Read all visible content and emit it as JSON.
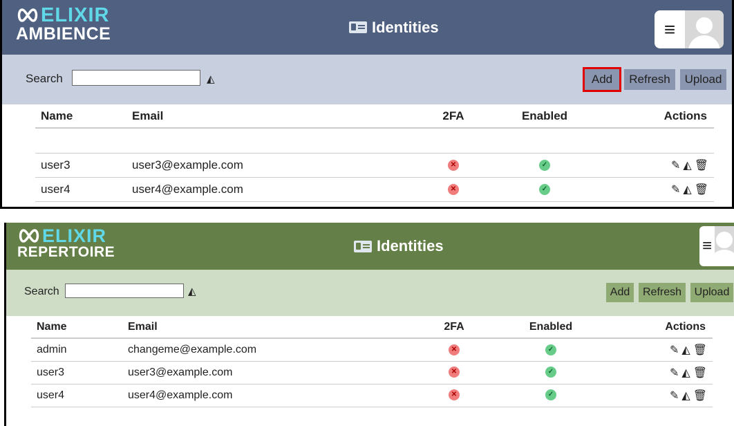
{
  "panels": [
    {
      "logo": {
        "brand": "ELIXIR",
        "product": "AMBIENCE"
      },
      "title": "Identities",
      "toolbar": {
        "search_label": "Search",
        "search_value": "",
        "add": "Add",
        "refresh": "Refresh",
        "upload": "Upload",
        "highlight": "Add"
      },
      "columns": {
        "name": "Name",
        "email": "Email",
        "tfa": "2FA",
        "enabled": "Enabled",
        "actions": "Actions"
      },
      "rows": [
        {
          "name": "",
          "email": "",
          "tfa": null,
          "enabled": null
        },
        {
          "name": "user3",
          "email": "user3@example.com",
          "tfa": false,
          "enabled": true
        },
        {
          "name": "user4",
          "email": "user4@example.com",
          "tfa": false,
          "enabled": true
        }
      ],
      "colors": {
        "header": "#506080",
        "toolbar": "#c8d0e0",
        "button": "#8a96b0"
      }
    },
    {
      "logo": {
        "brand": "ELIXIR",
        "product": "REPERTOIRE"
      },
      "title": "Identities",
      "toolbar": {
        "search_label": "Search",
        "search_value": "",
        "add": "Add",
        "refresh": "Refresh",
        "upload": "Upload"
      },
      "columns": {
        "name": "Name",
        "email": "Email",
        "tfa": "2FA",
        "enabled": "Enabled",
        "actions": "Actions"
      },
      "rows": [
        {
          "name": "admin",
          "email": "changeme@example.com",
          "tfa": false,
          "enabled": true
        },
        {
          "name": "user3",
          "email": "user3@example.com",
          "tfa": false,
          "enabled": true
        },
        {
          "name": "user4",
          "email": "user4@example.com",
          "tfa": false,
          "enabled": true
        }
      ],
      "colors": {
        "header": "#647f47",
        "toolbar": "#cfdcc6",
        "button": "#8faa72"
      }
    }
  ],
  "icons": {
    "menu": "hamburger-icon",
    "avatar": "avatar-icon",
    "clear": "eraser-icon",
    "edit": "pencil-icon",
    "reset": "eraser-icon",
    "delete": "trash-icon",
    "no": "x-icon",
    "yes": "check-icon"
  }
}
